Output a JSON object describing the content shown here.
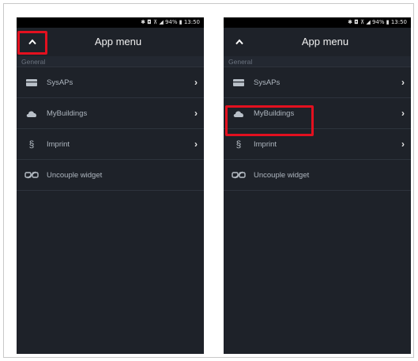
{
  "status_text": "13:50",
  "battery_text": "94%",
  "phones": [
    {
      "app_title": "App menu",
      "section_label": "General",
      "items": [
        {
          "label": "SysAPs",
          "icon": "server-icon",
          "has_chevron": true
        },
        {
          "label": "MyBuildings",
          "icon": "cloud-icon",
          "has_chevron": true
        },
        {
          "label": "Imprint",
          "icon": "section-sign-icon",
          "has_chevron": true
        },
        {
          "label": "Uncouple widget",
          "icon": "unlink-icon",
          "has_chevron": false
        }
      ]
    },
    {
      "app_title": "App menu",
      "section_label": "General",
      "items": [
        {
          "label": "SysAPs",
          "icon": "server-icon",
          "has_chevron": true
        },
        {
          "label": "MyBuildings",
          "icon": "cloud-icon",
          "has_chevron": true
        },
        {
          "label": "Imprint",
          "icon": "section-sign-icon",
          "has_chevron": true
        },
        {
          "label": "Uncouple widget",
          "icon": "unlink-icon",
          "has_chevron": false
        }
      ]
    }
  ],
  "highlight_color": "#e3101f"
}
